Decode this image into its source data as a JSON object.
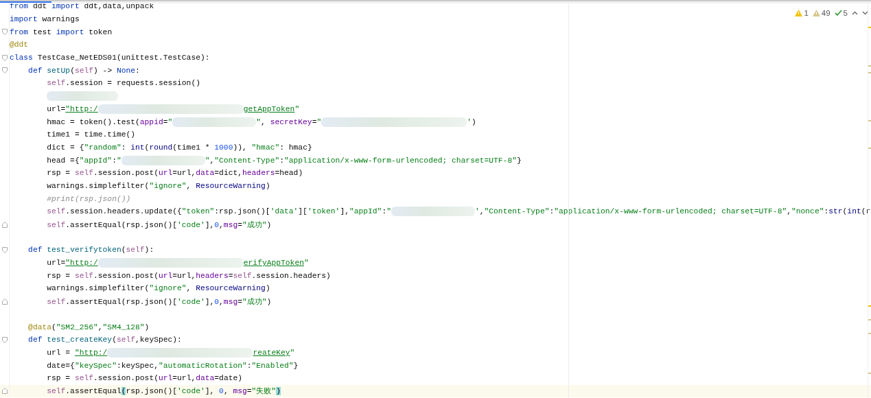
{
  "inspections": [
    {
      "kind": "warning",
      "count": "1"
    },
    {
      "kind": "weak_warning",
      "count": "49"
    },
    {
      "kind": "typo",
      "count": "5"
    }
  ],
  "lines": [
    {
      "kind": "code",
      "tokens": [
        {
          "kind": "keyword",
          "text": "from"
        },
        {
          "kind": "plain",
          "text": " ddt "
        },
        {
          "kind": "keyword",
          "text": "import"
        },
        {
          "kind": "plain",
          "text": " ddt,data,unpack"
        }
      ]
    },
    {
      "kind": "code",
      "tokens": [
        {
          "kind": "keyword",
          "text": "import"
        },
        {
          "kind": "plain",
          "text": " warnings"
        }
      ]
    },
    {
      "kind": "code",
      "fold_start": true,
      "tokens": [
        {
          "kind": "keyword",
          "text": "from"
        },
        {
          "kind": "plain",
          "text": " test "
        },
        {
          "kind": "keyword",
          "text": "import"
        },
        {
          "kind": "plain",
          "text": " token"
        }
      ]
    },
    {
      "kind": "code",
      "tokens": [
        {
          "kind": "decorator",
          "text": "@ddt"
        }
      ]
    },
    {
      "kind": "code",
      "fold_start": true,
      "tokens": [
        {
          "kind": "keyword",
          "text": "class"
        },
        {
          "kind": "plain",
          "text": " TestCase_NetEDS01(unittest.TestCase):"
        }
      ],
      "children": [
        {
          "kind": "code",
          "fold_start": true,
          "tokens": [
            {
              "kind": "keyword",
              "text": "def "
            },
            {
              "kind": "function",
              "text": "setUp"
            },
            {
              "kind": "plain",
              "text": "("
            },
            {
              "kind": "self",
              "text": "self"
            },
            {
              "kind": "plain",
              "text": ") -> "
            },
            {
              "kind": "keyword",
              "text": "None"
            },
            {
              "kind": "plain",
              "text": ":"
            }
          ],
          "children": [
            {
              "kind": "code",
              "tokens": [
                {
                  "kind": "self",
                  "text": "self"
                },
                {
                  "kind": "plain",
                  "text": ".session = requests.session()"
                }
              ]
            },
            {
              "kind": "code",
              "tokens": [
                {
                  "kind": "redacted_short"
                }
              ]
            },
            {
              "kind": "code",
              "tokens": [
                {
                  "kind": "plain",
                  "text": "url="
                },
                {
                  "kind": "link",
                  "text": "\"http:/"
                },
                {
                  "kind": "redacted_long"
                },
                {
                  "kind": "link",
                  "text": "getAppToken"
                },
                {
                  "kind": "string",
                  "text": "\""
                }
              ]
            },
            {
              "kind": "code",
              "tokens": [
                {
                  "kind": "plain",
                  "text": "hmac = token().test("
                },
                {
                  "kind": "param",
                  "text": "appid"
                },
                {
                  "kind": "plain",
                  "text": "="
                },
                {
                  "kind": "string",
                  "text": "\""
                },
                {
                  "kind": "redacted_medium"
                },
                {
                  "kind": "string",
                  "text": "\""
                },
                {
                  "kind": "plain",
                  "text": ", "
                },
                {
                  "kind": "param",
                  "text": "secretKey"
                },
                {
                  "kind": "plain",
                  "text": "="
                },
                {
                  "kind": "string",
                  "text": "\""
                },
                {
                  "kind": "redacted_long"
                },
                {
                  "kind": "string",
                  "text": "'"
                },
                {
                  "kind": "plain",
                  "text": ")"
                }
              ]
            },
            {
              "kind": "code",
              "tokens": [
                {
                  "kind": "plain",
                  "text": "time1 = time.time()"
                }
              ]
            },
            {
              "kind": "code",
              "tokens": [
                {
                  "kind": "plain",
                  "text": "dict = {"
                },
                {
                  "kind": "string",
                  "text": "\"random\""
                },
                {
                  "kind": "plain",
                  "text": ": "
                },
                {
                  "kind": "builtin",
                  "text": "int"
                },
                {
                  "kind": "plain",
                  "text": "("
                },
                {
                  "kind": "builtin",
                  "text": "round"
                },
                {
                  "kind": "plain",
                  "text": "(time1 * "
                },
                {
                  "kind": "number",
                  "text": "1000"
                },
                {
                  "kind": "plain",
                  "text": ")), "
                },
                {
                  "kind": "string",
                  "text": "\"hmac\""
                },
                {
                  "kind": "plain",
                  "text": ": hmac}"
                }
              ]
            },
            {
              "kind": "code",
              "tokens": [
                {
                  "kind": "plain",
                  "text": "head ={"
                },
                {
                  "kind": "string",
                  "text": "\"appId\""
                },
                {
                  "kind": "plain",
                  "text": ":"
                },
                {
                  "kind": "string",
                  "text": "\""
                },
                {
                  "kind": "redacted_medium"
                },
                {
                  "kind": "string",
                  "text": "\""
                },
                {
                  "kind": "plain",
                  "text": ","
                },
                {
                  "kind": "string",
                  "text": "\"Content-Type\""
                },
                {
                  "kind": "plain",
                  "text": ":"
                },
                {
                  "kind": "string",
                  "text": "\"application/x-www-form-urlencoded; charset=UTF-8\""
                },
                {
                  "kind": "plain",
                  "text": "}"
                }
              ]
            },
            {
              "kind": "code",
              "tokens": [
                {
                  "kind": "plain",
                  "text": "rsp = "
                },
                {
                  "kind": "self",
                  "text": "self"
                },
                {
                  "kind": "plain",
                  "text": ".session.post("
                },
                {
                  "kind": "param",
                  "text": "url"
                },
                {
                  "kind": "plain",
                  "text": "=url,"
                },
                {
                  "kind": "param",
                  "text": "data"
                },
                {
                  "kind": "plain",
                  "text": "=dict,"
                },
                {
                  "kind": "param",
                  "text": "headers"
                },
                {
                  "kind": "plain",
                  "text": "=head)"
                }
              ]
            },
            {
              "kind": "code",
              "tokens": [
                {
                  "kind": "plain",
                  "text": "warnings.simplefilter("
                },
                {
                  "kind": "string",
                  "text": "\"ignore\""
                },
                {
                  "kind": "plain",
                  "text": ", "
                },
                {
                  "kind": "builtin",
                  "text": "ResourceWarning"
                },
                {
                  "kind": "plain",
                  "text": ")"
                }
              ]
            },
            {
              "kind": "code",
              "tokens": [
                {
                  "kind": "comment",
                  "text": "#print(rsp.json())"
                }
              ]
            },
            {
              "kind": "code",
              "tokens": [
                {
                  "kind": "self",
                  "text": "self"
                },
                {
                  "kind": "plain",
                  "text": ".session.headers.update({"
                },
                {
                  "kind": "string",
                  "text": "\"token\""
                },
                {
                  "kind": "plain",
                  "text": ":rsp.json()["
                },
                {
                  "kind": "string",
                  "text": "'data'"
                },
                {
                  "kind": "plain",
                  "text": "]["
                },
                {
                  "kind": "string",
                  "text": "'token'"
                },
                {
                  "kind": "plain",
                  "text": "],"
                },
                {
                  "kind": "string",
                  "text": "\"appId\""
                },
                {
                  "kind": "plain",
                  "text": ":"
                },
                {
                  "kind": "string",
                  "text": "\""
                },
                {
                  "kind": "redacted_medium"
                },
                {
                  "kind": "string",
                  "text": "'"
                },
                {
                  "kind": "plain",
                  "text": ","
                },
                {
                  "kind": "string",
                  "text": "\"Content-Type\""
                },
                {
                  "kind": "plain",
                  "text": ":"
                },
                {
                  "kind": "string",
                  "text": "\"application/x-www-form-urlencoded; charset=UTF-8\""
                },
                {
                  "kind": "plain",
                  "text": ","
                },
                {
                  "kind": "string",
                  "text": "\"nonce\""
                },
                {
                  "kind": "plain",
                  "text": ":"
                },
                {
                  "kind": "builtin",
                  "text": "str"
                },
                {
                  "kind": "plain",
                  "text": "("
                },
                {
                  "kind": "builtin",
                  "text": "int"
                },
                {
                  "kind": "plain",
                  "text": "(r"
                }
              ]
            },
            {
              "kind": "code",
              "fold_end": true,
              "tokens": [
                {
                  "kind": "self",
                  "text": "self"
                },
                {
                  "kind": "plain",
                  "text": ".assertEqual(rsp.json()["
                },
                {
                  "kind": "string",
                  "text": "'code'"
                },
                {
                  "kind": "plain",
                  "text": "],"
                },
                {
                  "kind": "number",
                  "text": "0"
                },
                {
                  "kind": "plain",
                  "text": ","
                },
                {
                  "kind": "param",
                  "text": "msg"
                },
                {
                  "kind": "plain",
                  "text": "="
                },
                {
                  "kind": "string",
                  "text": "\"成功\""
                },
                {
                  "kind": "plain",
                  "text": ")"
                }
              ]
            }
          ]
        },
        {
          "kind": "blank"
        },
        {
          "kind": "code",
          "fold_start": true,
          "tokens": [
            {
              "kind": "keyword",
              "text": "def "
            },
            {
              "kind": "function",
              "text": "test_verifytoken"
            },
            {
              "kind": "plain",
              "text": "("
            },
            {
              "kind": "self",
              "text": "self"
            },
            {
              "kind": "plain",
              "text": "):"
            }
          ],
          "children": [
            {
              "kind": "code",
              "tokens": [
                {
                  "kind": "plain",
                  "text": "url="
                },
                {
                  "kind": "link",
                  "text": "\"http:/"
                },
                {
                  "kind": "redacted_long"
                },
                {
                  "kind": "link",
                  "text": "erifyAppToken"
                },
                {
                  "kind": "string",
                  "text": "\""
                }
              ]
            },
            {
              "kind": "code",
              "tokens": [
                {
                  "kind": "plain",
                  "text": "rsp = "
                },
                {
                  "kind": "self",
                  "text": "self"
                },
                {
                  "kind": "plain",
                  "text": ".session.post("
                },
                {
                  "kind": "param",
                  "text": "url"
                },
                {
                  "kind": "plain",
                  "text": "=url,"
                },
                {
                  "kind": "param",
                  "text": "headers"
                },
                {
                  "kind": "plain",
                  "text": "="
                },
                {
                  "kind": "self",
                  "text": "self"
                },
                {
                  "kind": "plain",
                  "text": ".session.headers)"
                }
              ]
            },
            {
              "kind": "code",
              "tokens": [
                {
                  "kind": "plain",
                  "text": "warnings.simplefilter("
                },
                {
                  "kind": "string",
                  "text": "\"ignore\""
                },
                {
                  "kind": "plain",
                  "text": ", "
                },
                {
                  "kind": "builtin",
                  "text": "ResourceWarning"
                },
                {
                  "kind": "plain",
                  "text": ")"
                }
              ]
            },
            {
              "kind": "code",
              "fold_end": true,
              "tokens": [
                {
                  "kind": "self",
                  "text": "self"
                },
                {
                  "kind": "plain",
                  "text": ".assertEqual(rsp.json()["
                },
                {
                  "kind": "string",
                  "text": "'code'"
                },
                {
                  "kind": "plain",
                  "text": "],"
                },
                {
                  "kind": "number",
                  "text": "0"
                },
                {
                  "kind": "plain",
                  "text": ","
                },
                {
                  "kind": "param",
                  "text": "msg"
                },
                {
                  "kind": "plain",
                  "text": "="
                },
                {
                  "kind": "string",
                  "text": "\"成功\""
                },
                {
                  "kind": "plain",
                  "text": ")"
                }
              ]
            }
          ]
        },
        {
          "kind": "blank"
        },
        {
          "kind": "code",
          "tokens": [
            {
              "kind": "decorator",
              "text": "@data"
            },
            {
              "kind": "plain",
              "text": "("
            },
            {
              "kind": "string",
              "text": "\"SM2_256\""
            },
            {
              "kind": "plain",
              "text": ","
            },
            {
              "kind": "string",
              "text": "\"SM4_128\""
            },
            {
              "kind": "plain",
              "text": ")"
            }
          ]
        },
        {
          "kind": "code",
          "fold_start": true,
          "tokens": [
            {
              "kind": "keyword",
              "text": "def "
            },
            {
              "kind": "function",
              "text": "test_createKey"
            },
            {
              "kind": "plain",
              "text": "("
            },
            {
              "kind": "self",
              "text": "self"
            },
            {
              "kind": "plain",
              "text": ",keySpec):"
            }
          ],
          "children": [
            {
              "kind": "code",
              "tokens": [
                {
                  "kind": "plain",
                  "text": "url = "
                },
                {
                  "kind": "link",
                  "text": "\"http:/"
                },
                {
                  "kind": "redacted_long"
                },
                {
                  "kind": "link",
                  "text": "reateKey"
                },
                {
                  "kind": "string",
                  "text": "\""
                }
              ]
            },
            {
              "kind": "code",
              "tokens": [
                {
                  "kind": "plain",
                  "text": "date={"
                },
                {
                  "kind": "string",
                  "text": "\"keySpec\""
                },
                {
                  "kind": "plain",
                  "text": ":keySpec,"
                },
                {
                  "kind": "string",
                  "text": "\"automaticRotation\""
                },
                {
                  "kind": "plain",
                  "text": ":"
                },
                {
                  "kind": "string",
                  "text": "\"Enabled\""
                },
                {
                  "kind": "plain",
                  "text": "}"
                }
              ]
            },
            {
              "kind": "code",
              "tokens": [
                {
                  "kind": "plain",
                  "text": "rsp = "
                },
                {
                  "kind": "self",
                  "text": "self"
                },
                {
                  "kind": "plain",
                  "text": ".session.post("
                },
                {
                  "kind": "param",
                  "text": "url"
                },
                {
                  "kind": "plain",
                  "text": "=url,"
                },
                {
                  "kind": "param",
                  "text": "data"
                },
                {
                  "kind": "plain",
                  "text": "=date)"
                }
              ]
            },
            {
              "kind": "code",
              "fold_end": true,
              "current": true,
              "tokens": [
                {
                  "kind": "self",
                  "text": "self"
                },
                {
                  "kind": "plain",
                  "text": ".assertEqual"
                },
                {
                  "kind": "brace_match",
                  "text": "("
                },
                {
                  "kind": "plain",
                  "text": "rsp.json()["
                },
                {
                  "kind": "string",
                  "text": "'code'"
                },
                {
                  "kind": "plain",
                  "text": "], "
                },
                {
                  "kind": "number",
                  "text": "0"
                },
                {
                  "kind": "plain",
                  "text": ", "
                },
                {
                  "kind": "param",
                  "text": "msg"
                },
                {
                  "kind": "plain",
                  "text": "="
                },
                {
                  "kind": "string",
                  "text": "\"失败\""
                },
                {
                  "kind": "brace_match",
                  "text": ")"
                }
              ]
            }
          ]
        }
      ]
    }
  ]
}
